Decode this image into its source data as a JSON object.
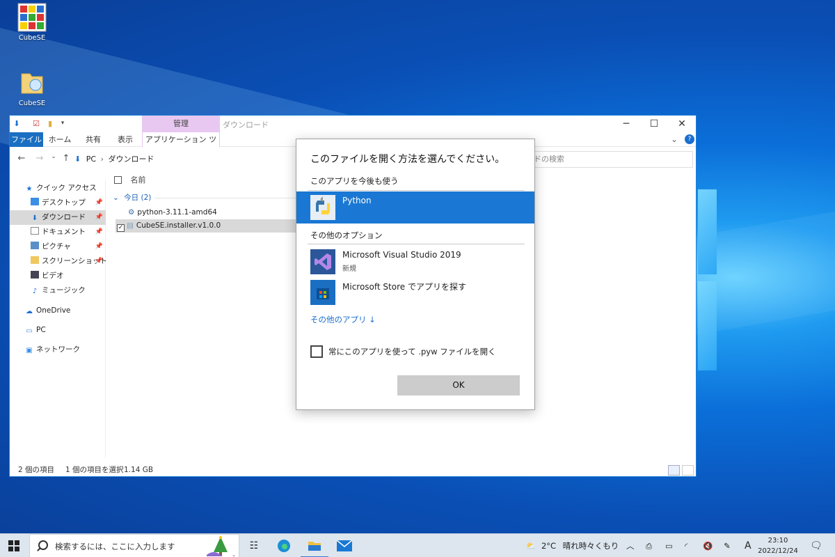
{
  "desktop": {
    "icons": [
      {
        "label": "CubeSE"
      },
      {
        "label": "CubeSE"
      }
    ]
  },
  "explorer": {
    "title": "ダウンロード",
    "manage_tab": "管理",
    "ribbon_tabs": [
      "ファイル",
      "ホーム",
      "共有",
      "表示",
      "アプリケーション ツール"
    ],
    "address": {
      "root": "PC",
      "current": "ダウンロード"
    },
    "search_placeholder": "ドの検索",
    "column_name": "名前",
    "nav": {
      "quick_access": "クイック アクセス",
      "items": [
        "デスクトップ",
        "ダウンロード",
        "ドキュメント",
        "ピクチャ",
        "スクリーンショット",
        "ビデオ",
        "ミュージック"
      ],
      "onedrive": "OneDrive",
      "pc": "PC",
      "network": "ネットワーク"
    },
    "group_header": "今日 (2)",
    "files": [
      "python-3.11.1-amd64",
      "CubeSE.installer.v1.0.0"
    ],
    "status": {
      "count": "2 個の項目",
      "selected": "1 個の項目を選択",
      "size": "1.14 GB"
    }
  },
  "dialog": {
    "title": "このファイルを開く方法を選んでください。",
    "section_keep": "このアプリを今後も使う",
    "selected_app": "Python",
    "section_other": "その他のオプション",
    "apps": [
      {
        "name": "Microsoft Visual Studio 2019",
        "sub": "新規"
      },
      {
        "name": "Microsoft Store でアプリを探す",
        "sub": ""
      }
    ],
    "more_apps": "その他のアプリ ↓",
    "always_use": "常にこのアプリを使って .pyw ファイルを開く",
    "ok": "OK"
  },
  "taskbar": {
    "search_placeholder": "検索するには、ここに入力します",
    "weather": "2°C",
    "weather_text": "晴れ時々くもり",
    "ime": "A",
    "time": "23:10",
    "date": "2022/12/24"
  },
  "colors": {
    "accent": "#1a78d4",
    "manage_tab": "#e8c8f0",
    "selection_gray": "#d9d9d9"
  }
}
